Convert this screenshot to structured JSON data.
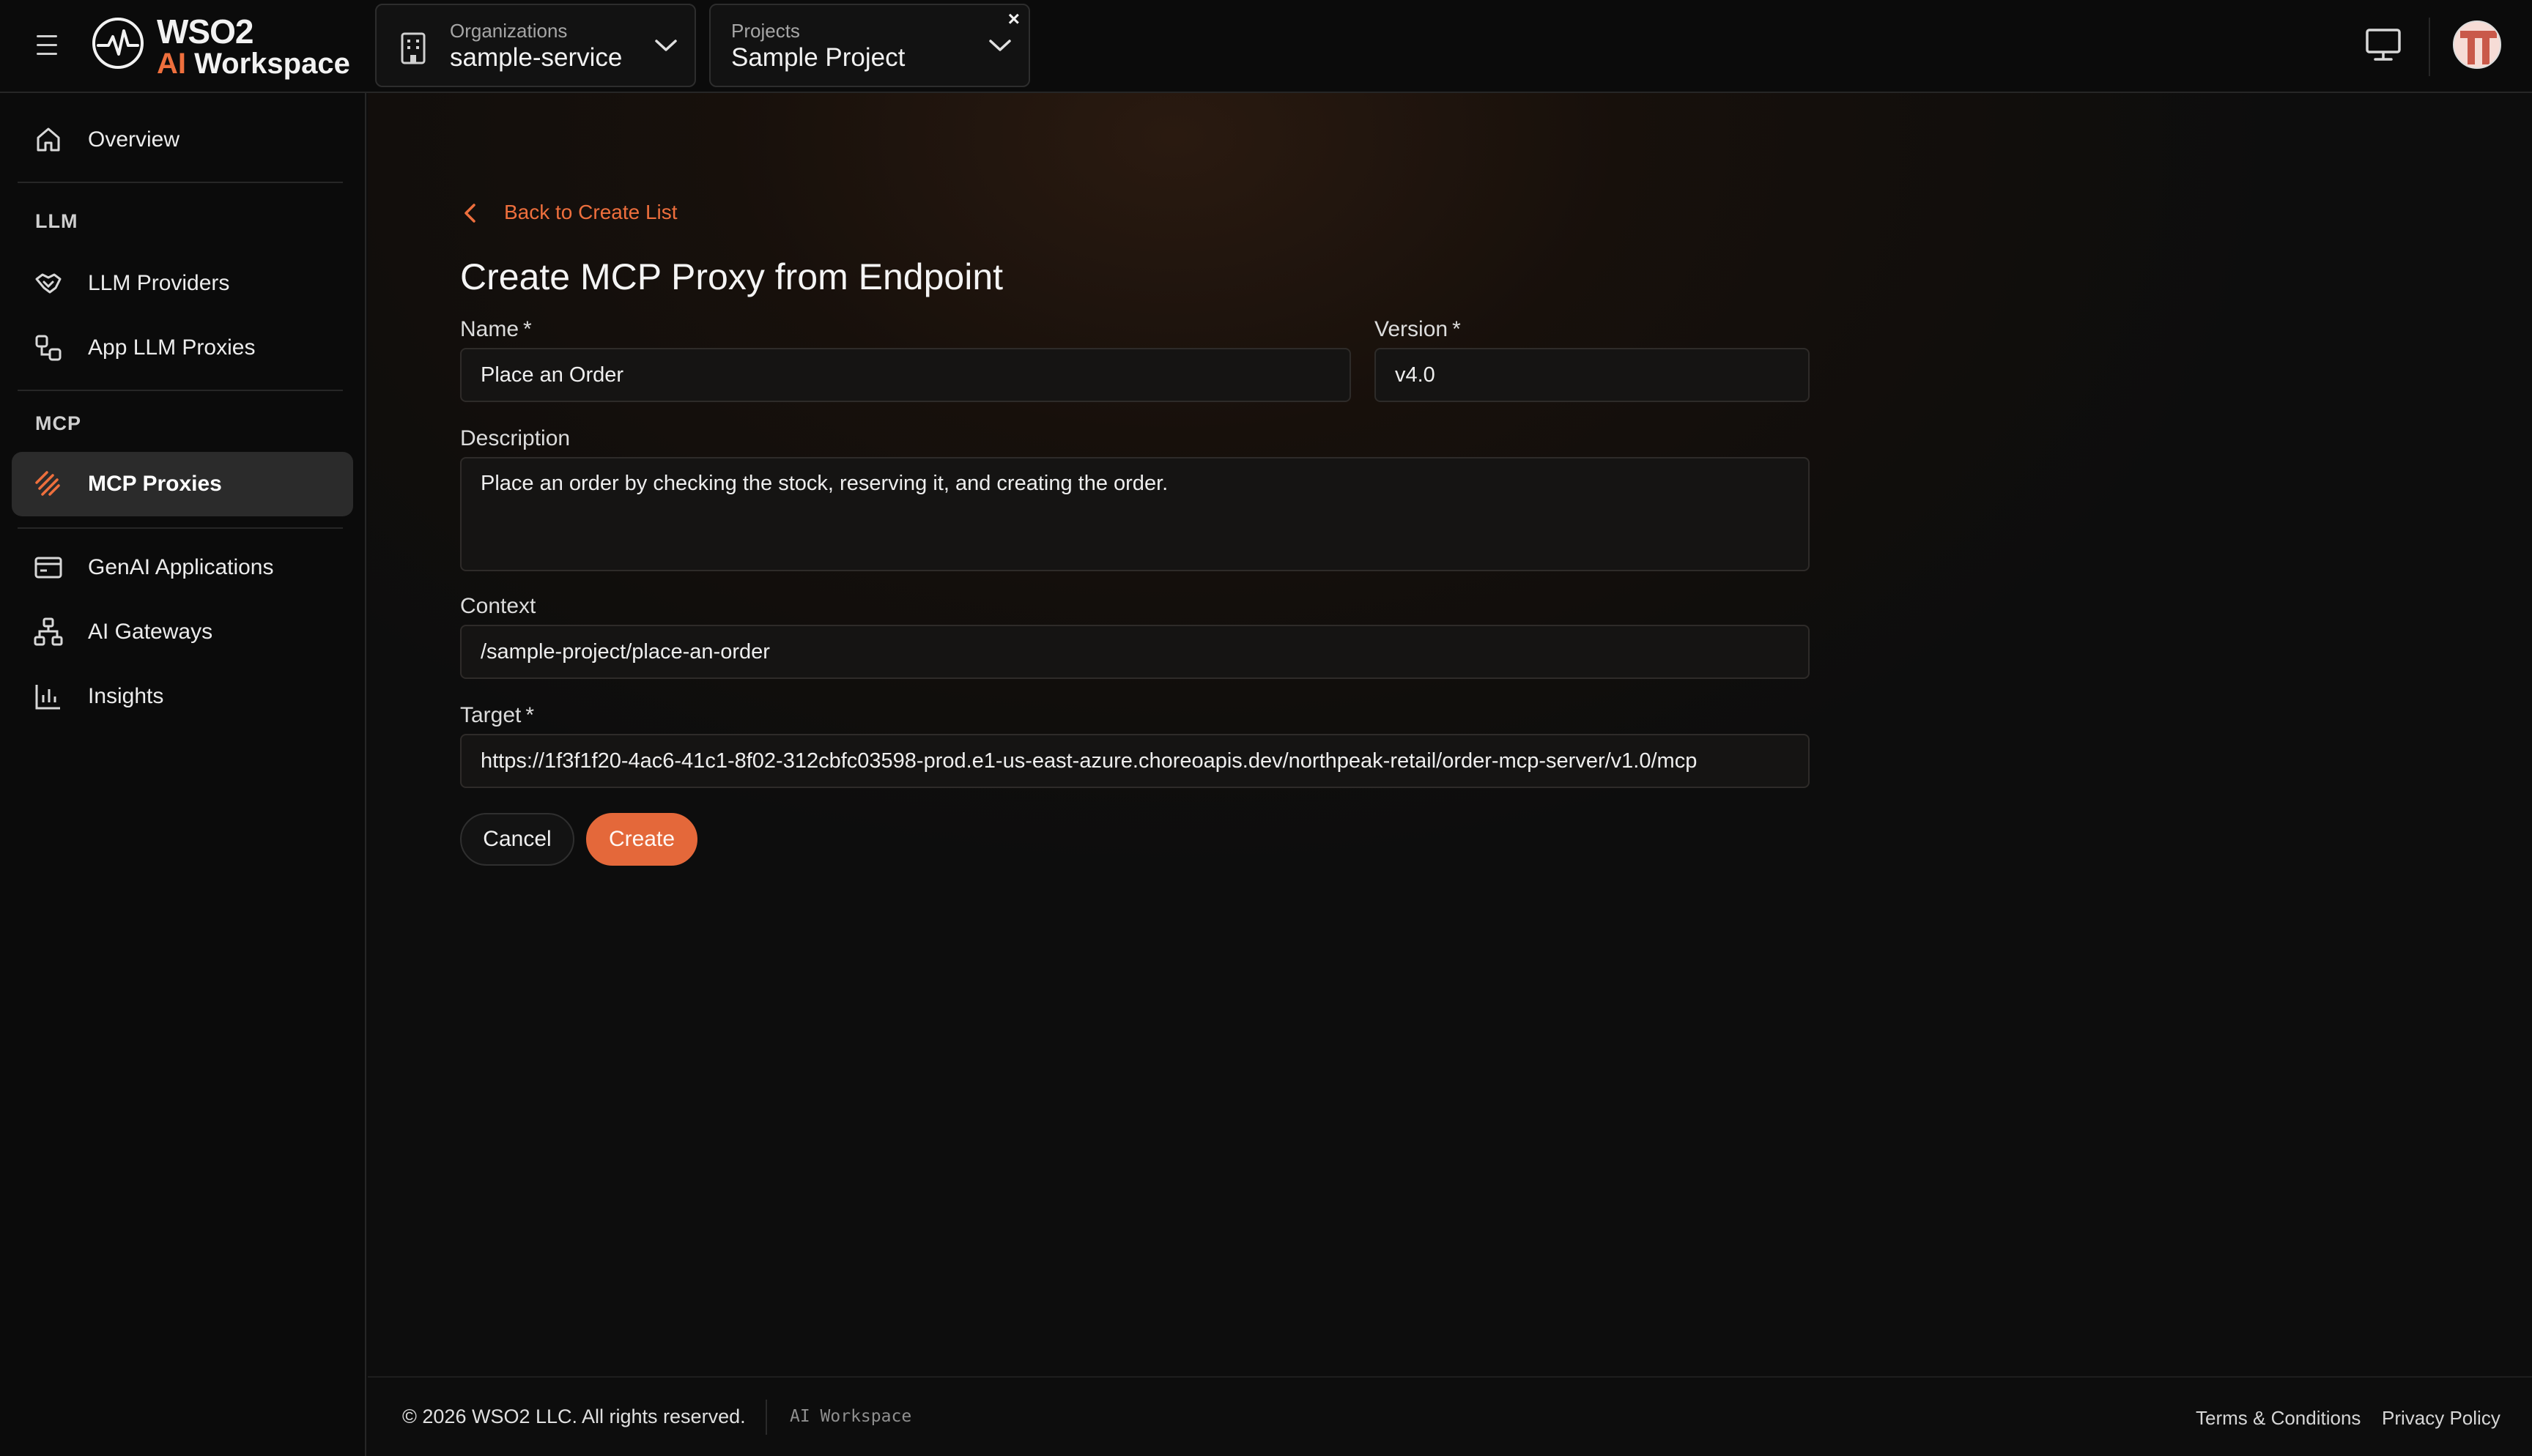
{
  "brand": {
    "name": "WSO2",
    "sub_prefix": "AI",
    "sub_rest": " Workspace"
  },
  "header": {
    "org": {
      "label": "Organizations",
      "value": "sample-service"
    },
    "project": {
      "label": "Projects",
      "value": "Sample Project",
      "close": "×"
    }
  },
  "sidebar": {
    "overview": "Overview",
    "llm_section": "LLM",
    "llm_providers": "LLM Providers",
    "app_llm_proxies": "App LLM Proxies",
    "mcp_section": "MCP",
    "mcp_proxies": "MCP Proxies",
    "genai_apps": "GenAI Applications",
    "ai_gateways": "AI Gateways",
    "insights": "Insights"
  },
  "page": {
    "back_label": "Back to Create List",
    "title": "Create MCP Proxy from Endpoint"
  },
  "form": {
    "name_label": "Name",
    "name_value": "Place an Order",
    "version_label": "Version",
    "version_value": "v4.0",
    "required_mark": "*",
    "description_label": "Description",
    "description_value": "Place an order by checking the stock, reserving it, and creating the order.",
    "context_label": "Context",
    "context_value": "/sample-project/place-an-order",
    "target_label": "Target",
    "target_value": "https://1f3f1f20-4ac6-41c1-8f02-312cbfc03598-prod.e1-us-east-azure.choreoapis.dev/northpeak-retail/order-mcp-server/v1.0/mcp",
    "cancel_label": "Cancel",
    "create_label": "Create"
  },
  "footer": {
    "copyright": "© 2026 WSO2 LLC. All rights reserved.",
    "brand": "AI Workspace",
    "terms": "Terms & Conditions",
    "privacy": "Privacy Policy"
  },
  "colors": {
    "accent": "#ee6f3d",
    "background": "#0d0d0d",
    "active_nav": "#2b2b2b"
  }
}
